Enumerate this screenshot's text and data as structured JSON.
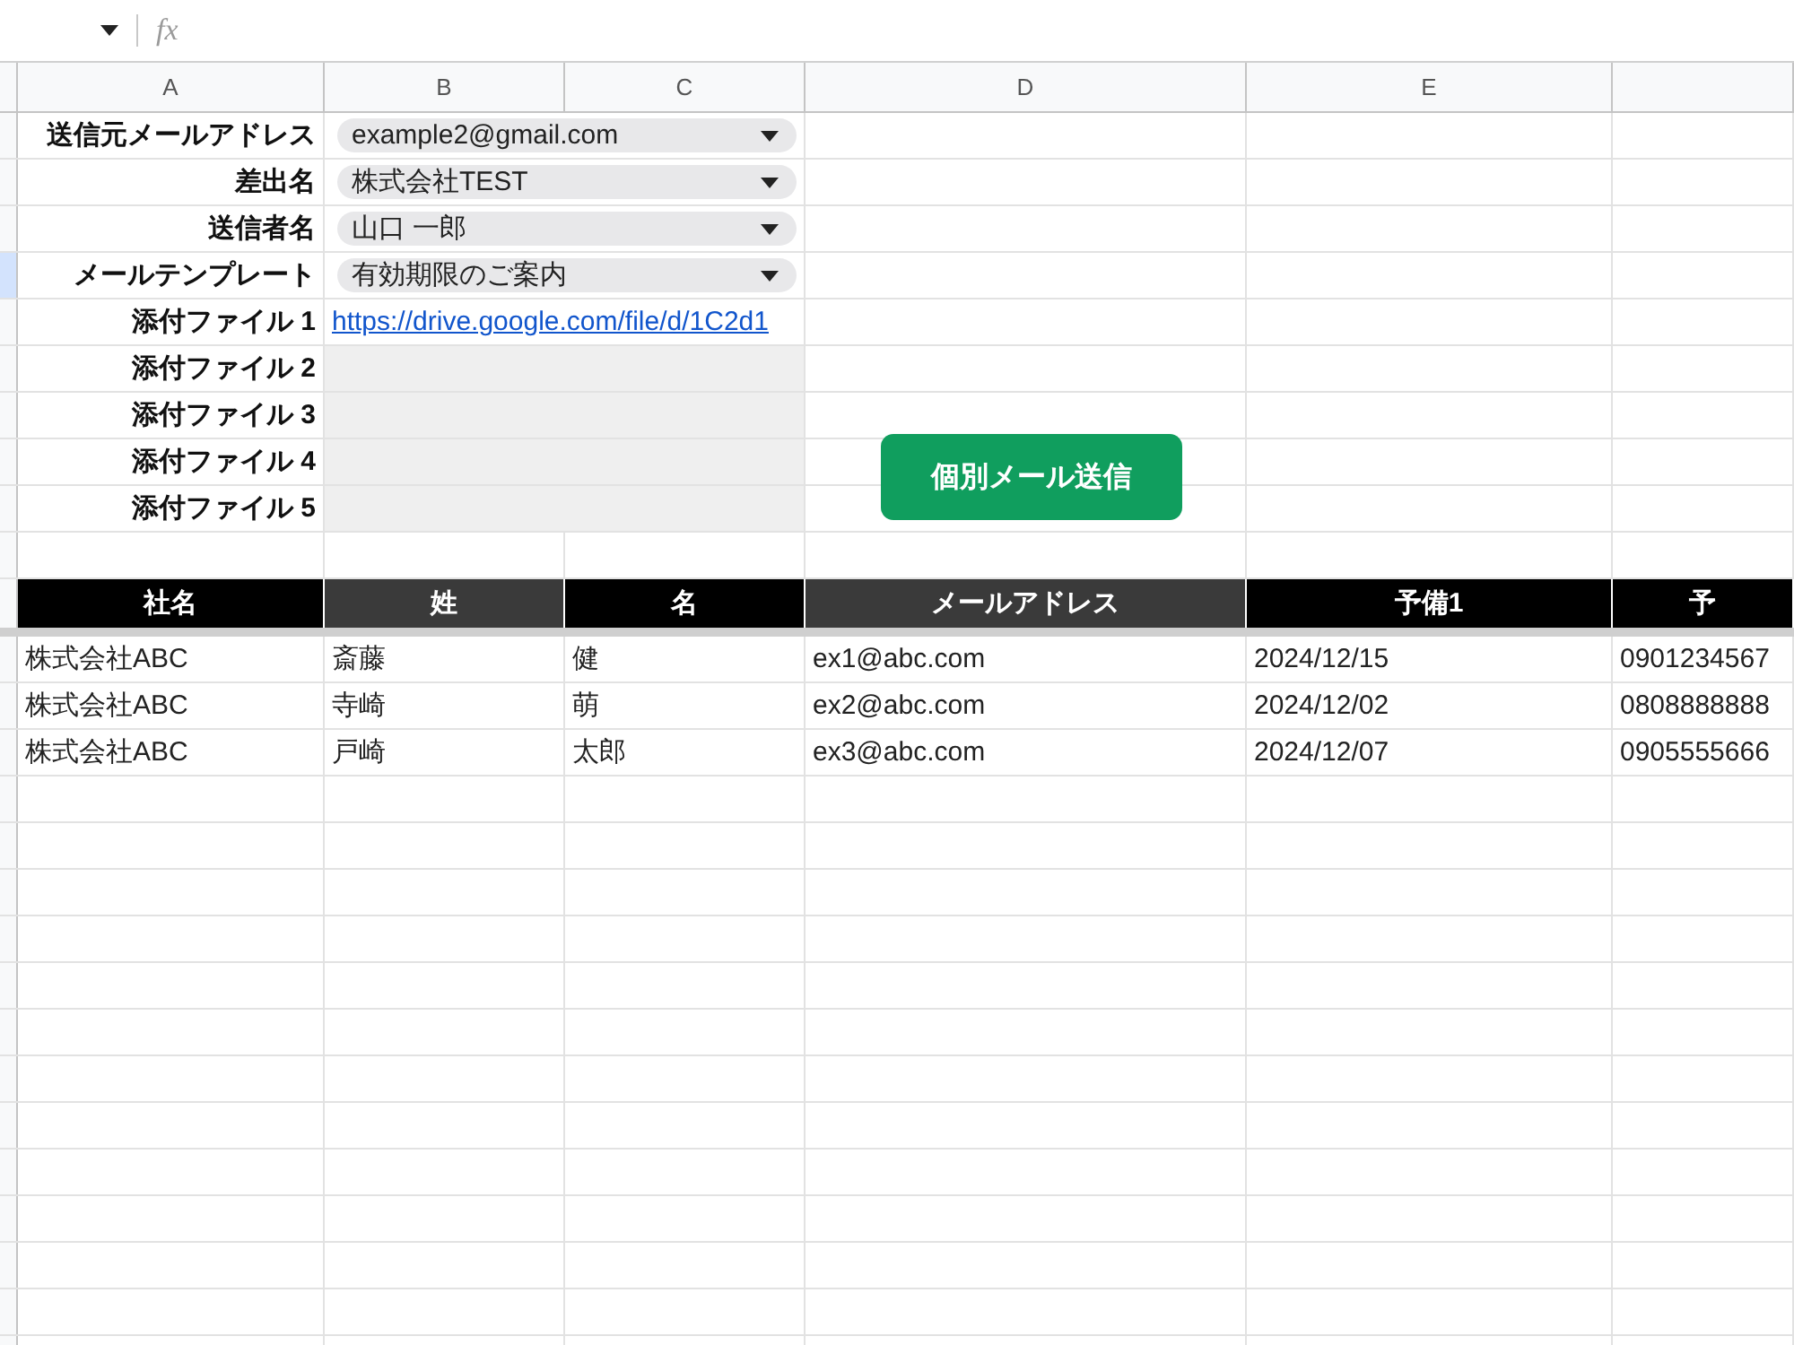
{
  "formula_bar": {
    "label": "fx"
  },
  "columns": [
    "A",
    "B",
    "C",
    "D",
    "E"
  ],
  "settings": [
    {
      "label": "送信元メールアドレス",
      "value": "example2@gmail.com",
      "selected": false
    },
    {
      "label": "差出名",
      "value": "株式会社TEST",
      "selected": false
    },
    {
      "label": "送信者名",
      "value": "山口 一郎",
      "selected": false
    },
    {
      "label": "メールテンプレート",
      "value": "有効期限のご案内",
      "selected": true
    }
  ],
  "attachments": [
    {
      "label": "添付ファイル 1",
      "value": "https://drive.google.com/file/d/1C2d1"
    },
    {
      "label": "添付ファイル 2"
    },
    {
      "label": "添付ファイル 3"
    },
    {
      "label": "添付ファイル 4"
    },
    {
      "label": "添付ファイル 5"
    }
  ],
  "send_button": "個別メール送信",
  "table": {
    "columns": [
      {
        "label": "社名",
        "color": "#000000"
      },
      {
        "label": "姓",
        "color": "#3a3a3a"
      },
      {
        "label": "名",
        "color": "#000000"
      },
      {
        "label": "メールアドレス",
        "color": "#3a3a3a"
      },
      {
        "label": "予備1",
        "color": "#000000"
      },
      {
        "label": "予",
        "color": "#000000"
      }
    ],
    "rows": [
      [
        "株式会社ABC",
        "斎藤",
        "健",
        "ex1@abc.com",
        "2024/12/15",
        "0901234567"
      ],
      [
        "株式会社ABC",
        "寺崎",
        "萌",
        "ex2@abc.com",
        "2024/12/02",
        "0808888888"
      ],
      [
        "株式会社ABC",
        "戸崎",
        "太郎",
        "ex3@abc.com",
        "2024/12/07",
        "0905555666"
      ]
    ]
  }
}
